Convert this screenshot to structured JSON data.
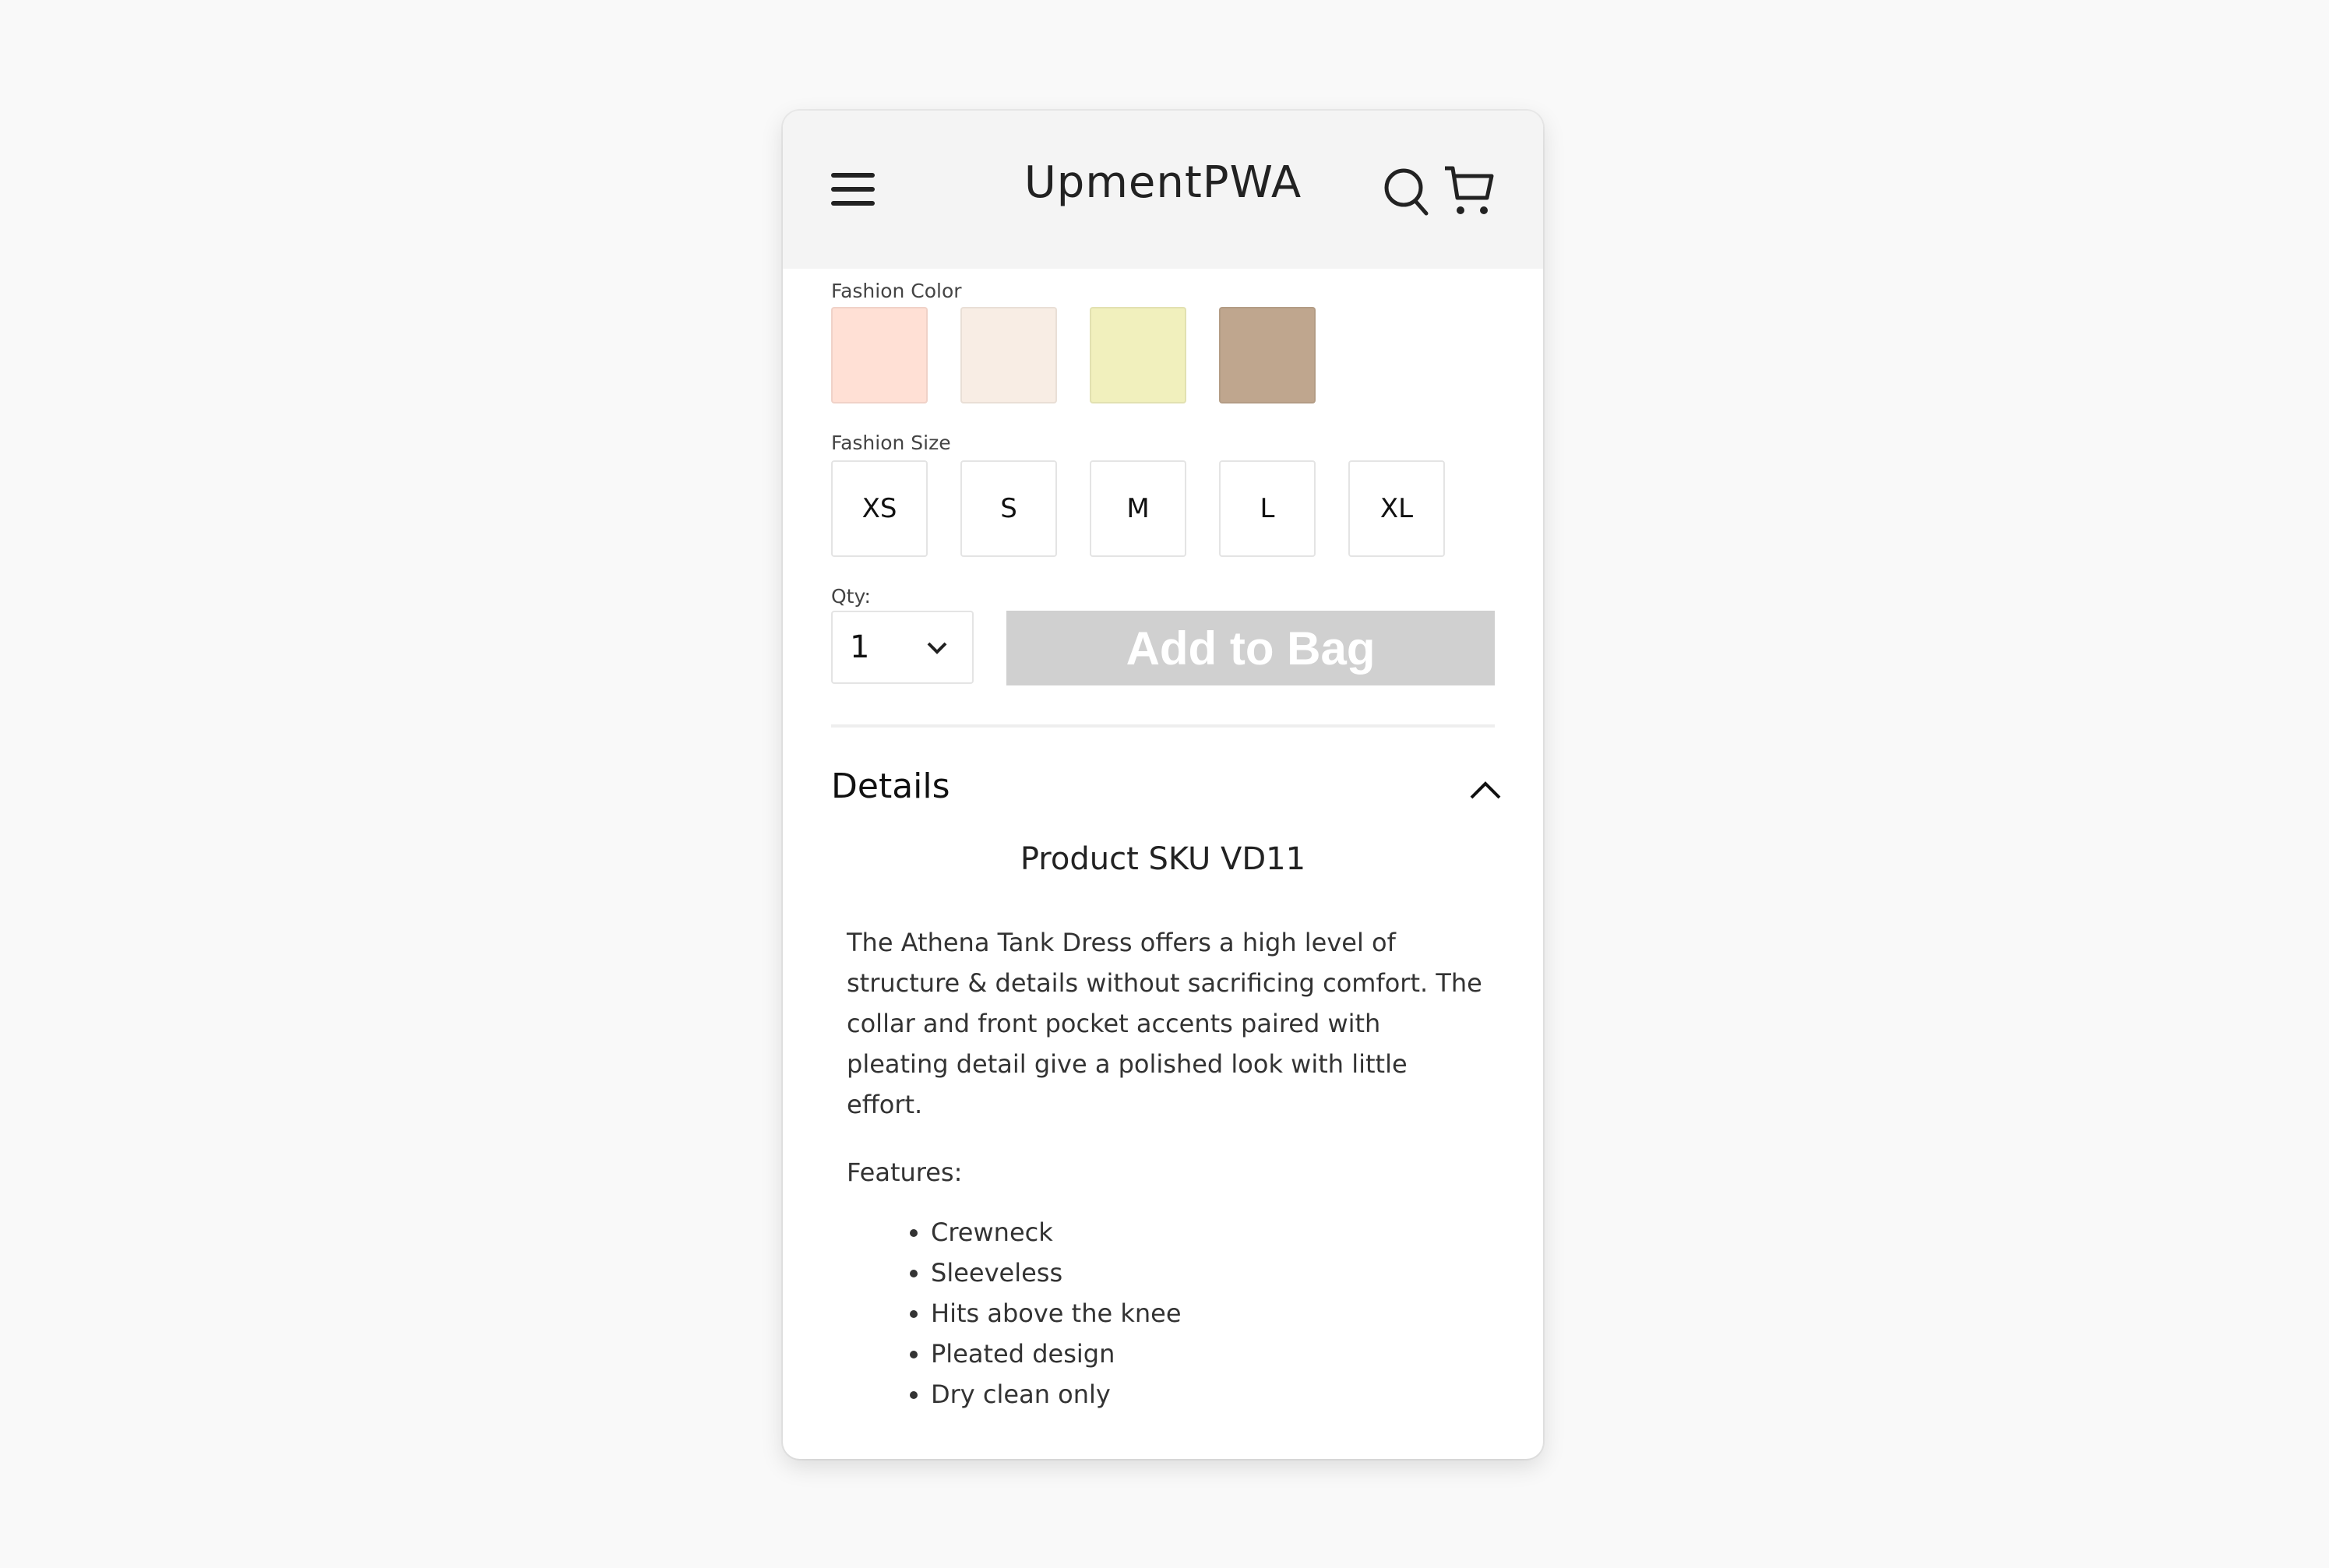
{
  "header": {
    "brand": "UpmentPWA",
    "menu_icon": "hamburger-menu-icon",
    "search_icon": "search-icon",
    "cart_icon": "shopping-cart-icon"
  },
  "options": {
    "color_label": "Fashion Color",
    "colors": [
      {
        "name": "swatch-1",
        "hex": "#ffe0d5"
      },
      {
        "name": "swatch-2",
        "hex": "#f8ede4"
      },
      {
        "name": "swatch-3",
        "hex": "#f1f0bd"
      },
      {
        "name": "swatch-4",
        "hex": "#bfa68e"
      }
    ],
    "size_label": "Fashion Size",
    "sizes": [
      "XS",
      "S",
      "M",
      "L",
      "XL"
    ]
  },
  "purchase": {
    "qty_label": "Qty:",
    "qty_value": "1",
    "add_to_bag_label": "Add to Bag",
    "add_to_bag_color": "#d0d0d0"
  },
  "details": {
    "title": "Details",
    "expanded": true,
    "sku": "Product SKU VD11",
    "description": "The Athena Tank Dress offers a high level of structure & details without sacrificing comfort. The collar and front pocket accents paired with pleating detail give a polished look with little effort.",
    "features_label": "Features:",
    "features": [
      "Crewneck",
      "Sleeveless",
      "Hits above the knee",
      "Pleated design",
      "Dry clean only"
    ]
  }
}
